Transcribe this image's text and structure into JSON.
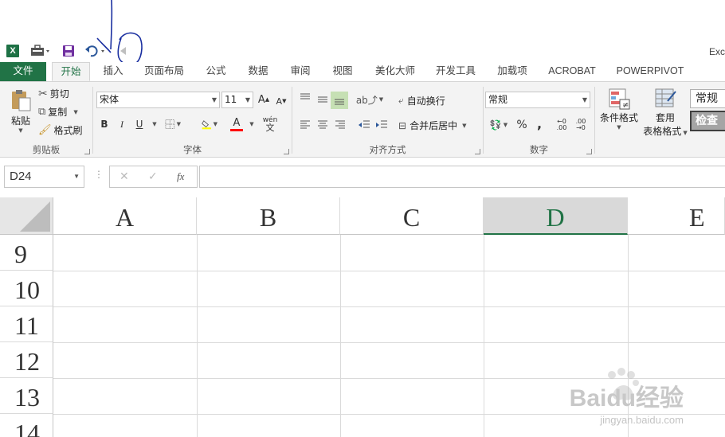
{
  "window": {
    "title_partial": "Exc"
  },
  "qat": {
    "excel_icon": "X",
    "icons": [
      "excel-logo-icon",
      "toolbox-icon",
      "save-icon",
      "undo-icon",
      "redo-icon"
    ]
  },
  "tabs": [
    {
      "label": "文件"
    },
    {
      "label": "开始"
    },
    {
      "label": "插入"
    },
    {
      "label": "页面布局"
    },
    {
      "label": "公式"
    },
    {
      "label": "数据"
    },
    {
      "label": "审阅"
    },
    {
      "label": "视图"
    },
    {
      "label": "美化大师"
    },
    {
      "label": "开发工具"
    },
    {
      "label": "加载项"
    },
    {
      "label": "ACROBAT"
    },
    {
      "label": "POWERPIVOT"
    }
  ],
  "ribbon": {
    "clipboard": {
      "label": "剪贴板",
      "paste": "粘贴",
      "cut": "剪切",
      "copy": "复制",
      "format_painter": "格式刷"
    },
    "font": {
      "label": "字体",
      "font_name": "宋体",
      "font_size": "11",
      "grow": "A",
      "shrink": "A",
      "bold": "B",
      "italic": "I",
      "underline": "U",
      "phonetic": "wén",
      "font_color": "A"
    },
    "alignment": {
      "label": "对齐方式",
      "wrap_text": "自动换行",
      "merge_center": "合并后居中"
    },
    "number": {
      "label": "数字",
      "format": "常规",
      "percent": "%",
      "comma": ",",
      "inc_decimal": ".00",
      "dec_decimal": ".00"
    },
    "styles": {
      "conditional_format": "条件格式",
      "table_format_1": "套用",
      "table_format_2": "表格格式",
      "cell_style_normal": "常规",
      "cell_style_check": "检查"
    }
  },
  "formula_bar": {
    "name_box": "D24",
    "cancel": "✕",
    "enter": "✓",
    "fx": "fx",
    "value": ""
  },
  "grid": {
    "columns": [
      "A",
      "B",
      "C",
      "D",
      "E"
    ],
    "selected_column": "D",
    "rows": [
      "9",
      "10",
      "11",
      "12",
      "13",
      "14"
    ]
  },
  "watermark": {
    "brand": "Baidu经验",
    "url": "jingyan.baidu.com"
  }
}
